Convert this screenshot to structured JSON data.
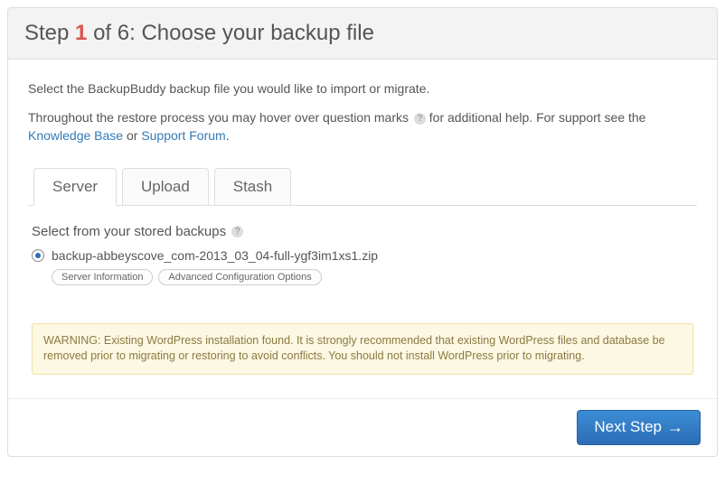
{
  "header": {
    "step_word": "Step",
    "step_num": "1",
    "step_rest": " of 6: Choose your backup file"
  },
  "intro": "Select the BackupBuddy backup file you would like to import or migrate.",
  "help": {
    "pre": "Throughout the restore process you may hover over question marks ",
    "post": " for additional help. For support see the ",
    "kb": "Knowledge Base",
    "or": " or ",
    "forum": "Support Forum",
    "end": "."
  },
  "tabs": {
    "server": "Server",
    "upload": "Upload",
    "stash": "Stash"
  },
  "stored_label": "Select from your stored backups",
  "backup": {
    "filename": "backup-abbeyscove_com-2013_03_04-full-ygf3im1xs1.zip"
  },
  "pills": {
    "server_info": "Server Information",
    "adv_config": "Advanced Configuration Options"
  },
  "warning": "WARNING: Existing WordPress installation found. It is strongly recommended that existing WordPress files and database be removed prior to migrating or restoring to avoid conflicts. You should not install WordPress prior to migrating.",
  "footer": {
    "next": "Next Step"
  }
}
